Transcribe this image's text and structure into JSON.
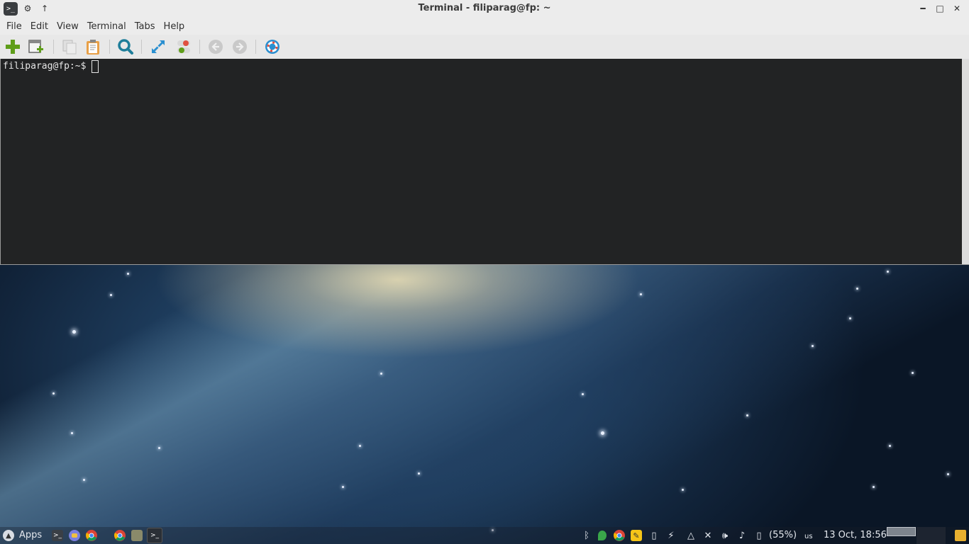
{
  "window": {
    "title": "Terminal - filiparag@fp: ~",
    "app_icon": ">_",
    "title_left_buttons": [
      "gear-icon",
      "arrow-up-icon"
    ],
    "controls": [
      "minimize-icon",
      "maximize-icon",
      "close-icon"
    ]
  },
  "menu": {
    "items": [
      {
        "label": "File"
      },
      {
        "label": "Edit"
      },
      {
        "label": "View"
      },
      {
        "label": "Terminal"
      },
      {
        "label": "Tabs"
      },
      {
        "label": "Help"
      }
    ]
  },
  "toolbar": {
    "icons": [
      "new-tab-icon",
      "new-window-icon",
      "copy-icon",
      "paste-icon",
      "search-icon",
      "fullscreen-icon",
      "toggle-icon",
      "previous-tab-icon",
      "next-tab-icon",
      "help-icon"
    ]
  },
  "terminal": {
    "prompt": "filiparag@fp:~$",
    "background": "#222324",
    "foreground": "#e6e6e6"
  },
  "taskbar": {
    "apps_label": "Apps",
    "launchers": [
      "terminal-icon",
      "messenger-icon",
      "chrome-icon",
      "chrome-icon",
      "files-icon",
      "terminal-icon"
    ],
    "tray_icons": [
      "bluetooth-icon",
      "leaf-icon",
      "chrome-icon",
      "notes-icon",
      "usb-icon",
      "battery-icon",
      "drive-icon",
      "tools-icon",
      "volume-icon",
      "bell-icon",
      "mouse-icon"
    ],
    "battery_percent": "(55%)",
    "keyboard_layout": "us",
    "datetime": "13 Oct, 18:56",
    "folder_icon": "folder-icon"
  },
  "colors": {
    "accent_green": "#5f9e1a",
    "toolbar_blue": "#2a8fd0",
    "titlebar": "#ececec"
  }
}
